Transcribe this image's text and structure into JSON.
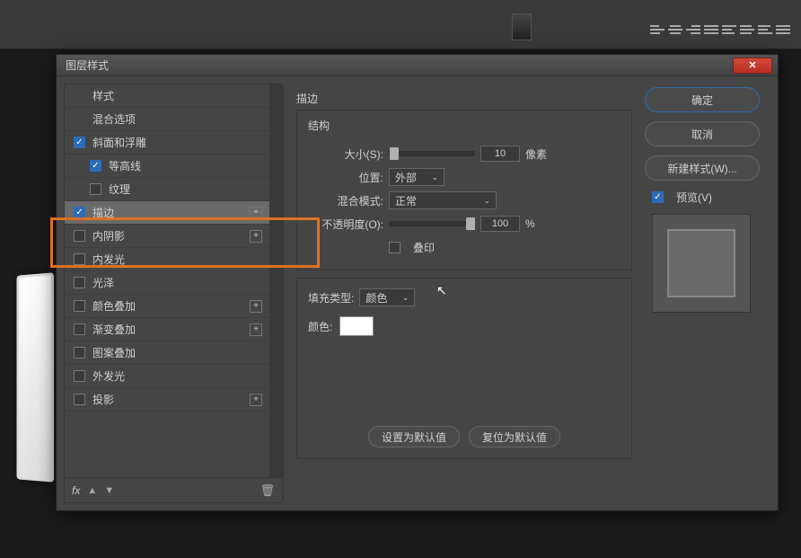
{
  "dialog": {
    "title": "图层样式",
    "close": "✕"
  },
  "styles": {
    "header": "样式",
    "blending": "混合选项",
    "items": [
      {
        "label": "斜面和浮雕",
        "checked": true,
        "sub": false,
        "plus": false
      },
      {
        "label": "等高线",
        "checked": true,
        "sub": true,
        "plus": false
      },
      {
        "label": "纹理",
        "checked": false,
        "sub": true,
        "plus": false
      },
      {
        "label": "描边",
        "checked": true,
        "sub": false,
        "plus": true,
        "selected": true
      },
      {
        "label": "内阴影",
        "checked": false,
        "sub": false,
        "plus": true
      },
      {
        "label": "内发光",
        "checked": false,
        "sub": false,
        "plus": false
      },
      {
        "label": "光泽",
        "checked": false,
        "sub": false,
        "plus": false
      },
      {
        "label": "颜色叠加",
        "checked": false,
        "sub": false,
        "plus": true
      },
      {
        "label": "渐变叠加",
        "checked": false,
        "sub": false,
        "plus": true
      },
      {
        "label": "图案叠加",
        "checked": false,
        "sub": false,
        "plus": false
      },
      {
        "label": "外发光",
        "checked": false,
        "sub": false,
        "plus": false
      },
      {
        "label": "投影",
        "checked": false,
        "sub": false,
        "plus": true
      }
    ],
    "fx_label": "fx"
  },
  "stroke": {
    "panel_title": "描边",
    "structure_label": "结构",
    "size_label": "大小(S):",
    "size_value": "10",
    "size_unit": "像素",
    "position_label": "位置:",
    "position_value": "外部",
    "blend_label": "混合模式:",
    "blend_value": "正常",
    "opacity_label": "不透明度(O):",
    "opacity_value": "100",
    "opacity_unit": "%",
    "overprint_label": "叠印",
    "fill_type_label": "填充类型:",
    "fill_type_value": "颜色",
    "color_label": "颜色:",
    "color_value": "#ffffff",
    "set_default": "设置为默认值",
    "reset_default": "复位为默认值"
  },
  "buttons": {
    "ok": "确定",
    "cancel": "取消",
    "new_style": "新建样式(W)...",
    "preview": "预览(V)"
  }
}
